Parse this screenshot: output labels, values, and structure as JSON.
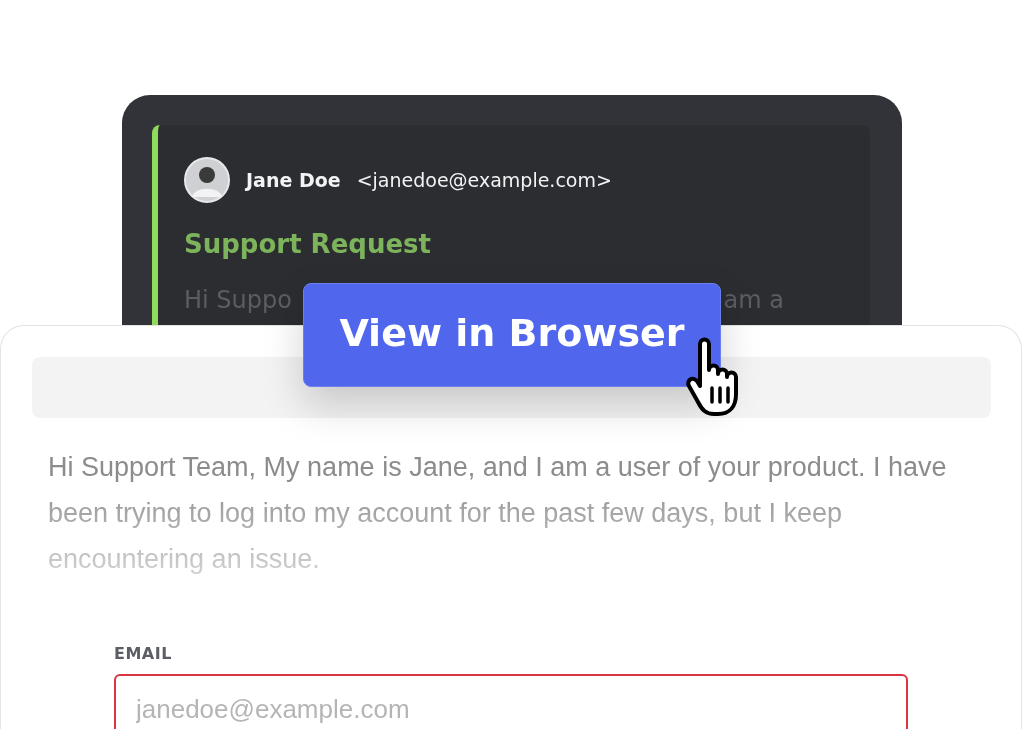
{
  "email_preview": {
    "sender_name": "Jane Doe",
    "sender_email": "<janedoe@example.com>",
    "subject": "Support Request",
    "snippet_start": "Hi Suppo",
    "snippet_end": "am a"
  },
  "action_button": {
    "label": "View in Browser"
  },
  "message": {
    "body": "Hi Support Team, My name is Jane, and I am a user of your product. I have been trying to log into my account for the past few days, but I keep encountering an issue."
  },
  "email_field": {
    "label": "EMAIL",
    "placeholder": "janedoe@example.com",
    "invalid": true
  }
}
